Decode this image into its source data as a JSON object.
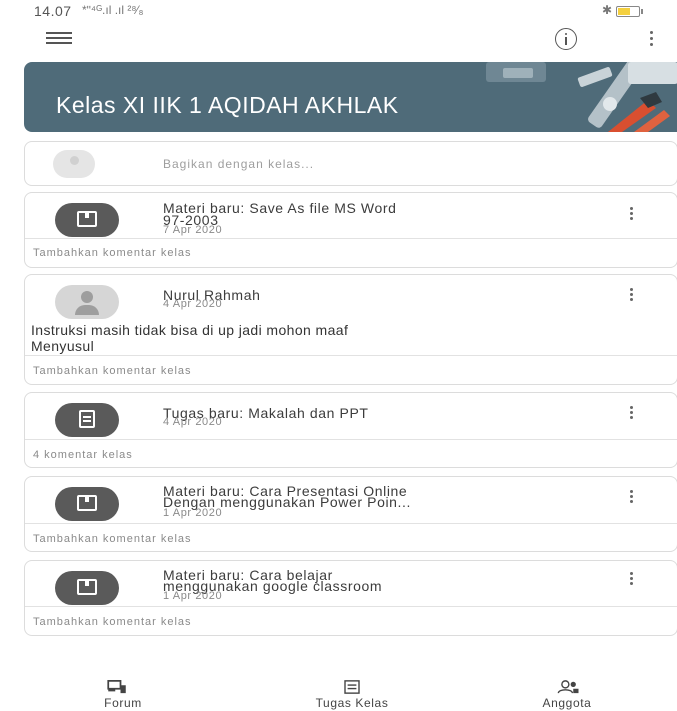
{
  "status_bar": {
    "time": "14.07",
    "signal": "*ʺ⁴ᴳ.ıl .ıl ²⁸⁄₈",
    "bluetooth": "✱"
  },
  "app_bar": {
    "menu_icon": "menu-icon",
    "info_icon": "info-icon",
    "more_icon": "more-vert-icon"
  },
  "banner": {
    "title": "Kelas  XI IIK 1 AQIDAH AKHLAK",
    "color": "#4f6b79"
  },
  "share": {
    "placeholder": "Bagikan dengan kelas..."
  },
  "posts": [
    {
      "title_line1": "Materi baru: Save As file MS Word",
      "title_line2": "97-2003",
      "date": "7 Apr 2020",
      "comment": "Tambahkan komentar kelas",
      "icon": "material-icon"
    },
    {
      "author": "Nurul Rahmah",
      "date": "4 Apr 2020",
      "body_line1": "Instruksi masih tidak bisa di up jadi mohon maaf",
      "body_line2": "Menyusul",
      "comment": "Tambahkan komentar kelas",
      "icon": "user-avatar-icon"
    },
    {
      "title_line1": "Tugas baru: Makalah dan PPT",
      "date": "4 Apr 2020",
      "comment": "4 komentar kelas",
      "icon": "assignment-icon"
    },
    {
      "title_line1": "Materi baru: Cara Presentasi Online",
      "title_line2": "Dengan menggunakan Power Poin...",
      "date": "1 Apr 2020",
      "comment": "Tambahkan komentar kelas",
      "icon": "material-icon"
    },
    {
      "title_line1": "Materi baru: Cara belajar",
      "title_line2": "menggunakan google classroom",
      "date": "1 Apr 2020",
      "comment": "Tambahkan komentar kelas",
      "icon": "material-icon"
    }
  ],
  "bottom_nav": [
    {
      "label": "Forum",
      "icon": "forum-icon"
    },
    {
      "label": "Tugas Kelas",
      "icon": "classwork-icon"
    },
    {
      "label": "Anggota",
      "icon": "people-icon"
    }
  ]
}
